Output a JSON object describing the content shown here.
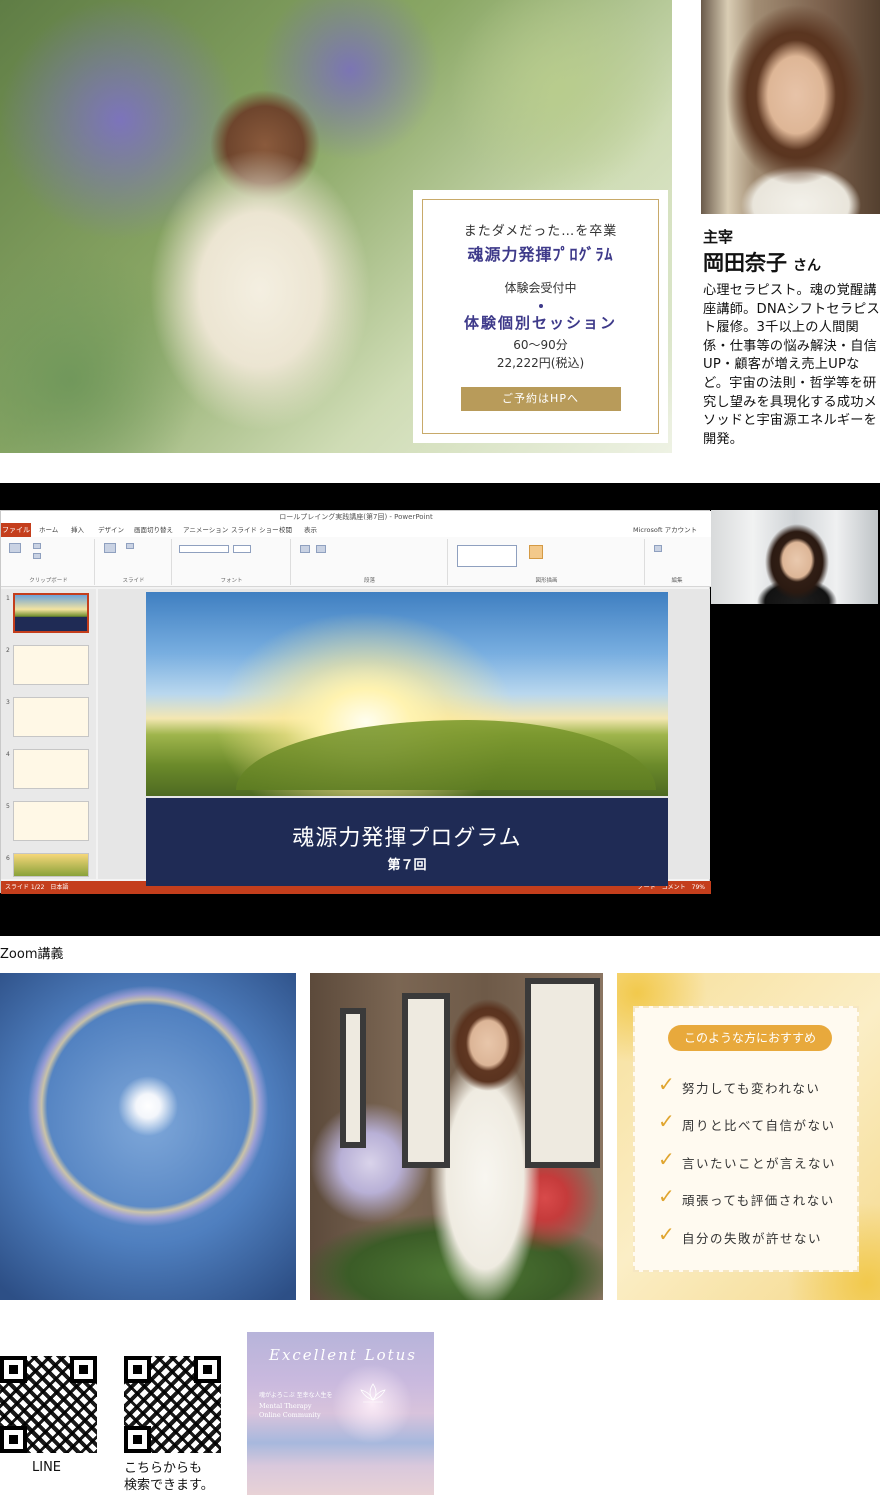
{
  "hero": {
    "card": {
      "line1": "またダメだった…を卒業",
      "program": "魂源力発揮ﾌﾟﾛｸﾞﾗﾑ",
      "status": "体験会受付中",
      "session": "体験個別セッション",
      "duration": "60〜90分",
      "price": "22,222円(税込)",
      "button": "ご予約はHPへ"
    }
  },
  "profile": {
    "role": "主宰",
    "name": "岡田奈子",
    "honorific": "さん",
    "bio": "心理セラピスト。魂の覚醒講座講師。DNAシフトセラピスト履修。3千以上の人間関係・仕事等の悩み解決・自信UP・顧客が増え売上UPなど。宇宙の法則・哲学等を研究し望みを具現化する成功メソッドと宇宙源エネルギーを開発。"
  },
  "zoom": {
    "window_title": "ロールプレイング実践講座(第7回) - PowerPoint",
    "file_tab": "ファイル",
    "tabs": [
      "ホーム",
      "挿入",
      "デザイン",
      "画面切り替え",
      "アニメーション",
      "スライド ショー",
      "校閲",
      "表示"
    ],
    "account": "Microsoft アカウント",
    "ribbon_groups": [
      "クリップボード",
      "スライド",
      "フォント",
      "段落",
      "図形描画",
      "編集"
    ],
    "slide_numbers": [
      "1",
      "2",
      "3",
      "4",
      "5",
      "6"
    ],
    "slide_title": "魂源力発揮プログラム",
    "slide_subtitle": "第７回",
    "status_left": "スライド 1/22　日本語",
    "status_right": "ノート　コメント　79%",
    "caption": "Zoom講義"
  },
  "recommend": {
    "title": "このような方におすすめ",
    "items": [
      "努力しても変われない",
      "周りと比べて自信がない",
      "言いたいことが言えない",
      "頑張っても評価されない",
      "自分の失敗が許せない"
    ]
  },
  "contact": {
    "qr1_label": "LINE",
    "qr2_label_line1": "こちらからも",
    "qr2_label_line2": "検索できます。"
  },
  "logo": {
    "name": "Excellent Lotus",
    "tagline": "魂がよろこぶ 至幸な人生を",
    "sub_line1": "Mental Therapy",
    "sub_line2": "Online Community"
  }
}
